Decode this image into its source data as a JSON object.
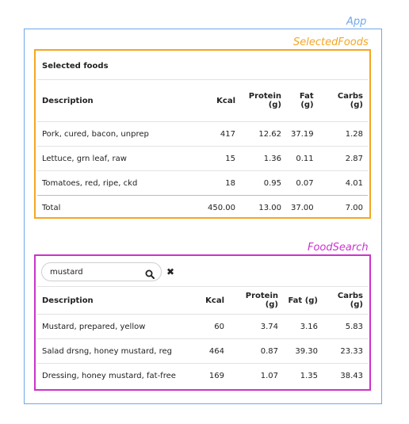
{
  "labels": {
    "app": "App",
    "selected_foods_component": "SelectedFoods",
    "food_search_component": "FoodSearch"
  },
  "colors": {
    "app": "#6fa8e8",
    "selected_foods": "#f5a623",
    "food_search": "#cc33cc"
  },
  "selected_foods": {
    "title": "Selected foods",
    "columns": [
      "Description",
      "Kcal",
      "Protein (g)",
      "Fat (g)",
      "Carbs (g)"
    ],
    "rows": [
      {
        "description": "Pork, cured, bacon, unprep",
        "kcal": "417",
        "protein": "12.62",
        "fat": "37.19",
        "carbs": "1.28"
      },
      {
        "description": "Lettuce, grn leaf, raw",
        "kcal": "15",
        "protein": "1.36",
        "fat": "0.11",
        "carbs": "2.87"
      },
      {
        "description": "Tomatoes, red, ripe, ckd",
        "kcal": "18",
        "protein": "0.95",
        "fat": "0.07",
        "carbs": "4.01"
      }
    ],
    "total": {
      "label": "Total",
      "kcal": "450.00",
      "protein": "13.00",
      "fat": "37.00",
      "carbs": "7.00"
    }
  },
  "food_search": {
    "search_value": "mustard",
    "search_icon": "search-icon",
    "clear_icon": "close-icon",
    "columns": [
      "Description",
      "Kcal",
      "Protein (g)",
      "Fat (g)",
      "Carbs (g)"
    ],
    "rows": [
      {
        "description": "Mustard, prepared, yellow",
        "kcal": "60",
        "protein": "3.74",
        "fat": "3.16",
        "carbs": "5.83"
      },
      {
        "description": "Salad drsng, honey mustard, reg",
        "kcal": "464",
        "protein": "0.87",
        "fat": "39.30",
        "carbs": "23.33"
      },
      {
        "description": "Dressing, honey mustard, fat-free",
        "kcal": "169",
        "protein": "1.07",
        "fat": "1.35",
        "carbs": "38.43"
      }
    ]
  }
}
